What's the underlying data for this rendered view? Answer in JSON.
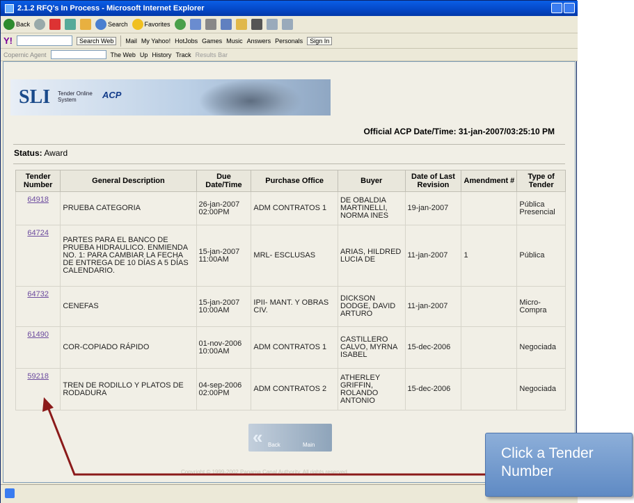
{
  "window": {
    "title": "2.1.2 RFQ's In Process - Microsoft Internet Explorer"
  },
  "toolbar": {
    "back": "Back",
    "search": "Search",
    "favorites": "Favorites"
  },
  "yahoo_bar": {
    "search_web": "Search Web",
    "items": [
      "Mail",
      "My Yahoo!",
      "HotJobs",
      "Games",
      "Music",
      "Answers",
      "Personals"
    ],
    "sign_in": "Sign In"
  },
  "copernic_bar": {
    "agent": "Copernic Agent",
    "scope": "The Web",
    "items": [
      "Up",
      "History",
      "Track",
      "Results Bar"
    ]
  },
  "banner": {
    "logo": "SLI",
    "subtitle": "Tender Online System",
    "acp": "ACP"
  },
  "official": "Official ACP Date/Time: 31-jan-2007/03:25:10 PM",
  "status": {
    "label": "Status:",
    "value": "Award"
  },
  "table": {
    "headers": [
      "Tender Number",
      "General Description",
      "Due Date/Time",
      "Purchase Office",
      "Buyer",
      "Date of Last Revision",
      "Amendment #",
      "Type of Tender"
    ],
    "rows": [
      [
        "64918",
        "PRUEBA CATEGORIA",
        "26-jan-2007 02:00PM",
        "ADM CONTRATOS 1",
        "DE OBALDIA MARTINELLI, NORMA INES",
        "19-jan-2007",
        "",
        "Pública Presencial"
      ],
      [
        "64724",
        "PARTES PARA EL BANCO DE PRUEBA HIDRAULICO. ENMIENDA NO. 1: PARA CAMBIAR LA FECHA DE ENTREGA DE 10 DÍAS A 5 DÍAS CALENDARIO.",
        "15-jan-2007 11:00AM",
        "MRL- ESCLUSAS",
        "ARIAS, HILDRED LUCIA DE",
        "11-jan-2007",
        "1",
        "Pública"
      ],
      [
        "64732",
        "CENEFAS",
        "15-jan-2007 10:00AM",
        "IPII- MANT. Y OBRAS CIV.",
        "DICKSON DODGE, DAVID ARTURO",
        "11-jan-2007",
        "",
        "Micro-Compra"
      ],
      [
        "61490",
        "COR-COPIADO RÁPIDO",
        "01-nov-2006 10:00AM",
        "ADM CONTRATOS 1",
        "CASTILLERO CALVO, MYRNA ISABEL",
        "15-dec-2006",
        "",
        "Negociada"
      ],
      [
        "59218",
        "TREN DE RODILLO Y PLATOS DE RODADURA",
        "04-sep-2006 02:00PM",
        "ADM CONTRATOS 2",
        "ATHERLEY GRIFFIN, ROLANDO ANTONIO",
        "15-dec-2006",
        "",
        "Negociada"
      ]
    ]
  },
  "nav": {
    "back": "Back",
    "main": "Main"
  },
  "copyright": "Copyright © 1999-2002 Panama Canal Authority. All rights reserved.",
  "callout": {
    "text": "Click a Tender Number"
  },
  "colors": {
    "arrow": "#8b1a1a",
    "callout": "#6f96cc",
    "link": "#6b4a9e"
  }
}
